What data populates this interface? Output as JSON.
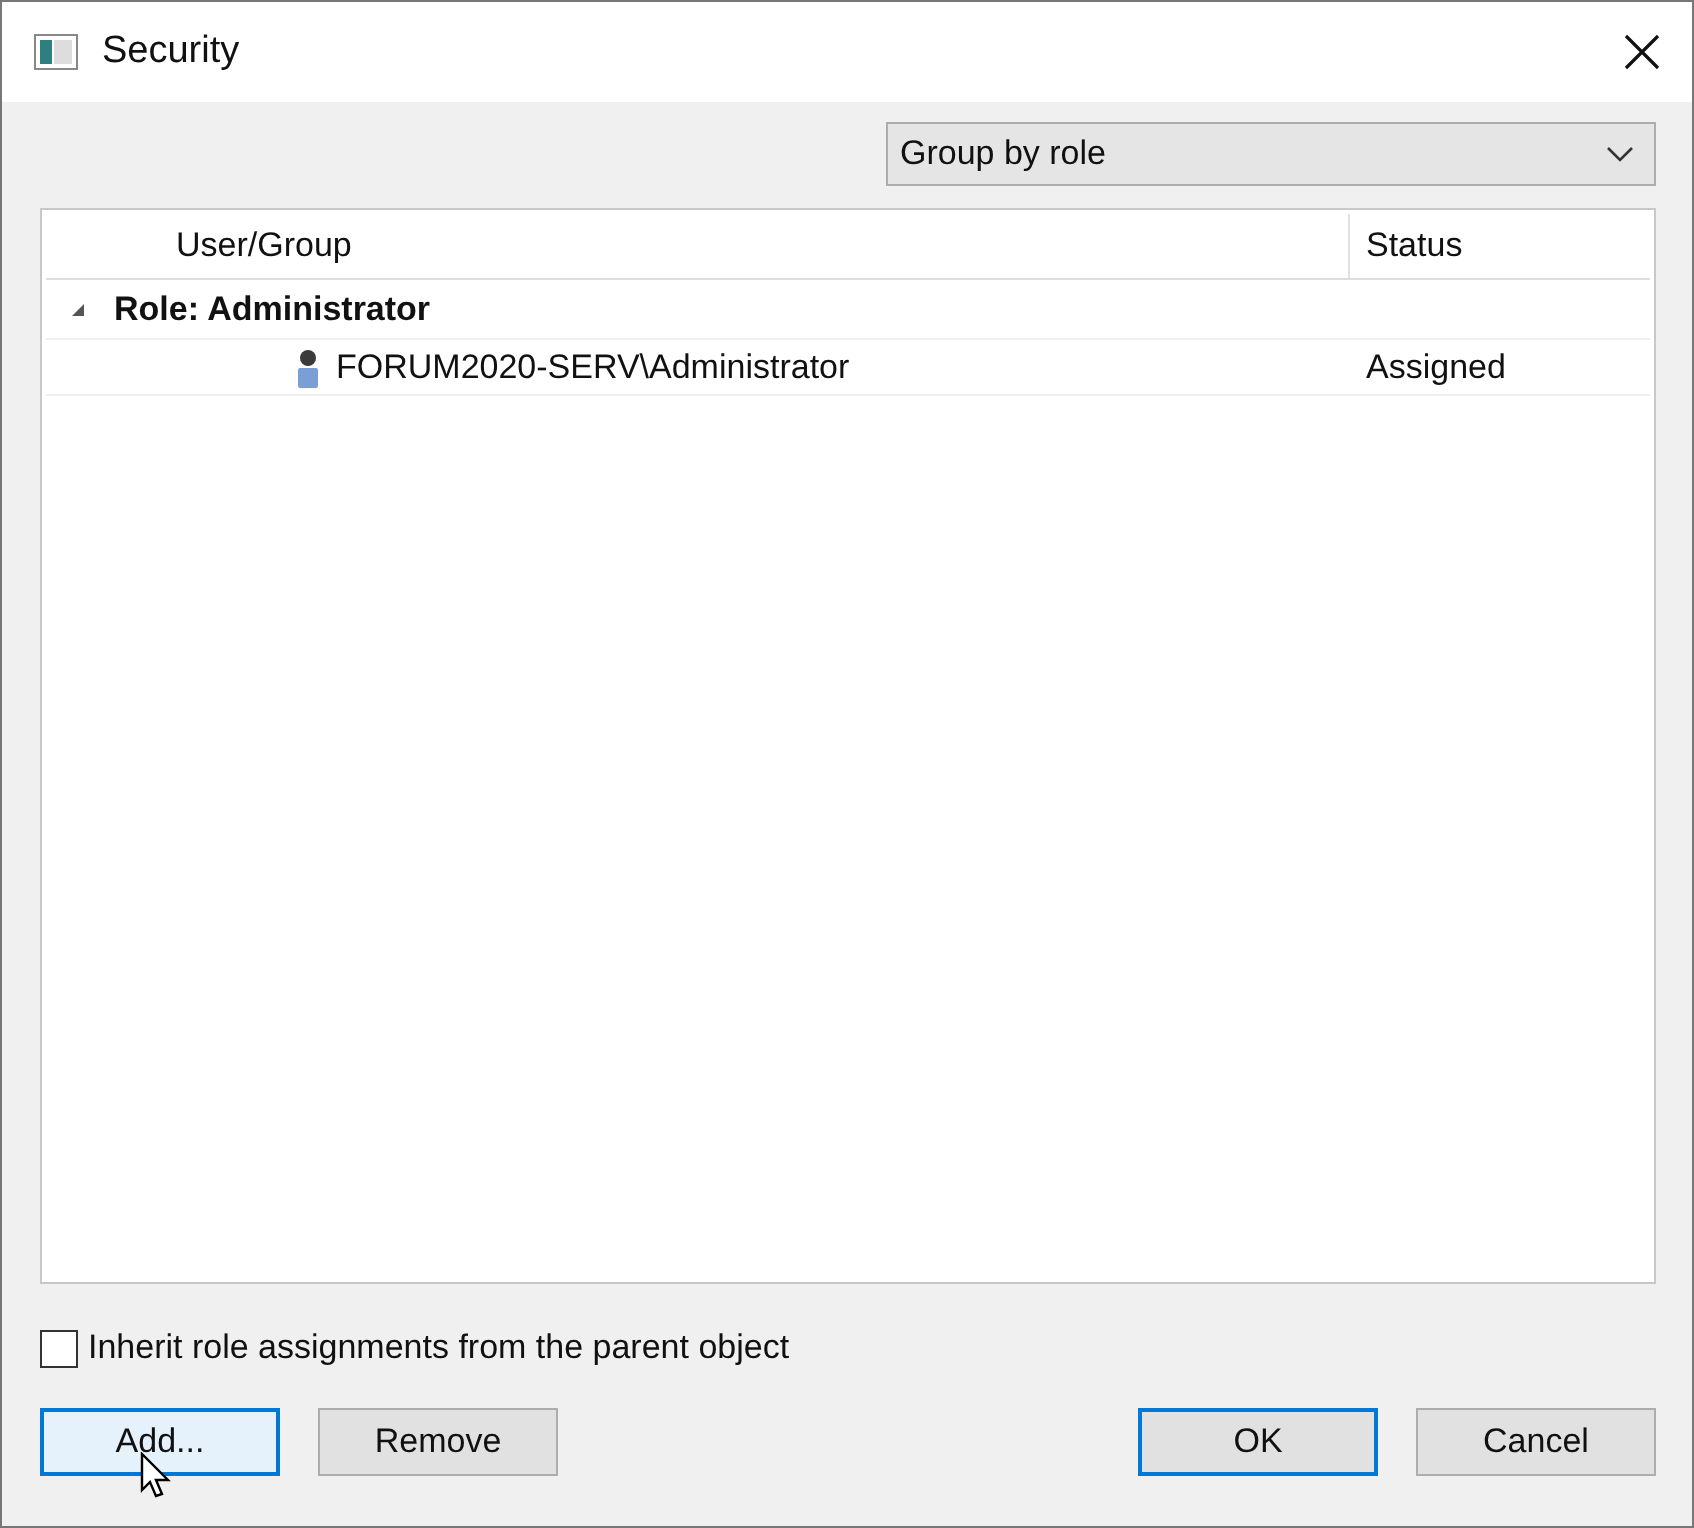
{
  "window": {
    "title": "Security"
  },
  "group_by": {
    "value": "Group by role"
  },
  "table": {
    "columns": [
      "User/Group",
      "Status"
    ],
    "groups": [
      {
        "label": "Role: Administrator",
        "expanded": true,
        "children": [
          {
            "name": "FORUM2020-SERV\\Administrator",
            "status": "Assigned"
          }
        ]
      }
    ]
  },
  "inherit": {
    "label": "Inherit role assignments from the parent object",
    "checked": false
  },
  "buttons": [
    {
      "label": "Add...",
      "hovered": true,
      "default": false
    },
    {
      "label": "Remove",
      "hovered": false,
      "default": false
    },
    {
      "label": "OK",
      "hovered": false,
      "default": true
    },
    {
      "label": "Cancel",
      "hovered": false,
      "default": false
    }
  ]
}
